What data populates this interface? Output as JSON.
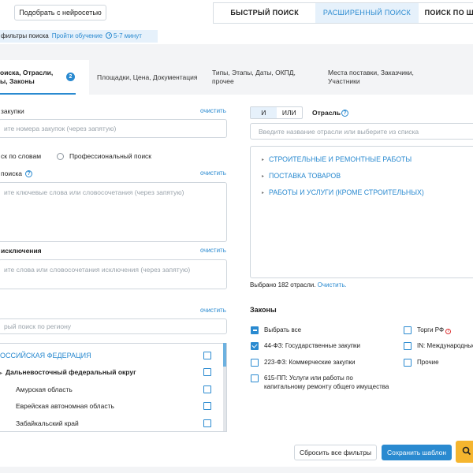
{
  "topbar": {
    "neuro_button": "Подобрать с нейросетью",
    "search_tabs": [
      "БЫСТРЫЙ ПОИСК",
      "РАСШИРЕННЫЙ ПОИСК",
      "ПОИСК ПО Ш"
    ]
  },
  "info": {
    "text": "фильтры поиска",
    "link": "Пройти обучение",
    "time": "5-7 минут"
  },
  "filter_tabs": [
    {
      "label_line1": "оиска, Отрасли,",
      "label_line2": "ы, Законы",
      "badge": "2"
    },
    {
      "label_line1": "Площадки, Цена, Документация",
      "label_line2": ""
    },
    {
      "label_line1": "Типы, Этапы, Даты, ОКПД,",
      "label_line2": "прочее"
    },
    {
      "label_line1": "Места поставки, Заказчики,",
      "label_line2": "Участники"
    }
  ],
  "left": {
    "purchase_numbers": {
      "label": "закупки",
      "clear": "очистить",
      "placeholder": "ите номера закупок (через запятую)"
    },
    "search_mode": {
      "option1": "ск по словам",
      "option2": "Профессиональный поиск"
    },
    "keywords": {
      "label": "поиска",
      "clear": "очистить",
      "placeholder": "ите ключевые слова или словосочетания (через запятую)"
    },
    "exclusions": {
      "label": "исключения",
      "clear": "очистить",
      "placeholder": "ите слова или словосочетания исключения (через запятую)"
    },
    "region": {
      "clear": "очистить",
      "placeholder": "рый поиск по региону",
      "items": [
        {
          "label": "ОССИЙСКАЯ ФЕДЕРАЦИЯ"
        },
        {
          "label": "Дальневосточный федеральный округ"
        },
        {
          "label": "Амурская область"
        },
        {
          "label": "Еврейская автономная область"
        },
        {
          "label": "Забайкальский край"
        }
      ]
    }
  },
  "right": {
    "and_label": "И",
    "or_label": "ИЛИ",
    "industry_label": "Отрасль",
    "industry_placeholder": "Введите название отрасли или выберите из списка",
    "tree_items": [
      "СТРОИТЕЛЬНЫЕ И РЕМОНТНЫЕ РАБОТЫ",
      "ПОСТАВКА ТОВАРОВ",
      "РАБОТЫ И УСЛУГИ (КРОМЕ СТРОИТЕЛЬНЫХ)"
    ],
    "selected_text": "Выбрано 182 отрасли.",
    "selected_clear": "Очистить.",
    "laws_title": "Законы",
    "laws": [
      {
        "label": "Выбрать все",
        "state": "partial"
      },
      {
        "label": "44-ФЗ: Государственные закупки",
        "state": "checked"
      },
      {
        "label": "223-ФЗ: Коммерческие закупки",
        "state": "unchecked"
      },
      {
        "label": "615-ПП: Услуги или работы по",
        "label2": "капитальному ремонту общего имущества",
        "state": "unchecked"
      },
      {
        "label": "Торги РФ",
        "state": "unchecked"
      },
      {
        "label": "IN: Международные",
        "state": "unchecked"
      },
      {
        "label": "Прочие",
        "state": "unchecked"
      }
    ]
  },
  "footer": {
    "reset": "Сбросить все фильтры",
    "save": "Сохранить шаблон"
  },
  "colors": {
    "accent": "#2a8ad0",
    "go_button": "#f5b52e"
  }
}
